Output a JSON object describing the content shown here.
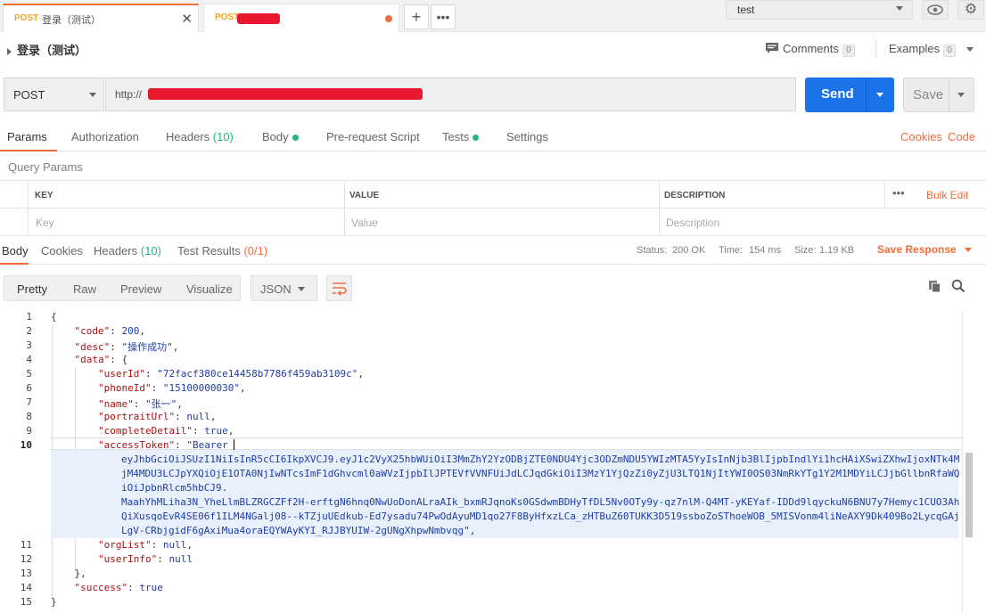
{
  "tabs": [
    {
      "method": "POST",
      "name": "登录（测试）"
    },
    {
      "method": "POST",
      "name": ""
    }
  ],
  "environment": {
    "selected": "test"
  },
  "request": {
    "name": "登录（测试）",
    "comments_label": "Comments",
    "comments_count": "0",
    "examples_label": "Examples",
    "examples_count": "0",
    "method": "POST",
    "url_prefix": "http://",
    "send_label": "Send",
    "save_label": "Save"
  },
  "request_tabs": {
    "params": "Params",
    "authorization": "Authorization",
    "headers": "Headers",
    "headers_count": "(10)",
    "body": "Body",
    "prerequest": "Pre-request Script",
    "tests": "Tests",
    "settings": "Settings",
    "cookies": "Cookies",
    "code": "Code"
  },
  "query_params": {
    "title": "Query Params",
    "col_key": "KEY",
    "col_value": "VALUE",
    "col_description": "DESCRIPTION",
    "bulk_edit": "Bulk Edit",
    "ph_key": "Key",
    "ph_value": "Value",
    "ph_description": "Description"
  },
  "response_tabs": {
    "body": "Body",
    "cookies": "Cookies",
    "headers": "Headers",
    "headers_count": "(10)",
    "test_results": "Test Results",
    "test_count": "(0/1)",
    "status_label": "Status:",
    "status_value": "200 OK",
    "time_label": "Time:",
    "time_value": "154 ms",
    "size_label": "Size:",
    "size_value": "1.19 KB",
    "save_response": "Save Response"
  },
  "response_toolbar": {
    "pretty": "Pretty",
    "raw": "Raw",
    "preview": "Preview",
    "visualize": "Visualize",
    "format": "JSON"
  },
  "body": {
    "line_numbers": [
      "1",
      "2",
      "3",
      "4",
      "5",
      "6",
      "7",
      "8",
      "9",
      "10",
      "11",
      "12",
      "13",
      "14",
      "15"
    ],
    "code_value": "200",
    "desc_value": "\"操作成功\"",
    "userId": "\"72facf380ce14458b7786f459ab3109c\"",
    "phoneId": "\"15100000030\"",
    "name": "\"张一\"",
    "portraitUrl": "null",
    "completeDetail": "true",
    "accessToken_start": "\"Bearer ",
    "token_lines": [
      "eyJhbGciOiJSUzI1NiIsInR5cCI6IkpXVCJ9.eyJ1c2VyX25hbWUiOiI3MmZhY2YzODBjZTE0NDU4Yjc3ODZmNDU5YWIzMTA5YyIsInNjb3BlIjpbIndlYi1hcHAiXSwiZXhwIjoxNTk4M",
      "jM4MDU3LCJpYXQiOjE1OTA0NjIwNTcsImF1dGhvcml0aWVzIjpbIlJPTEVfVVNFUiJdLCJqdGkiOiI3MzY1YjQzZi0yZjU3LTQ1NjItYWI0OS03NmRkYTg1Y2M1MDYiLCJjbGllbnRfaWQ",
      "iOiJpbnRlcm5hbCJ9.",
      "MaahYhMLiha3N_YheLlmBLZRGCZFf2H-erftgN6hnq0NwUoDonALraAIk_bxmRJqnoKs0GSdwmBDHyTfDL5Nv0OTy9y-qz7nlM-Q4MT-yKEYaf-IDDd9lqyckuN6BNU7y7Hemyc1CUO3Ah",
      "QiXusqoEvR4SE06f1ILM4NGalj08--kTZjuUEdkub-Ed7ysadu74PwOdAyuMD1qo27F8ByHfxzLCa_zHTBuZ60TUKK3D519ssboZoSThoeWOB_5MISVonm4liNeAXY9Dk409Bo2LycqGAj",
      "LgV-CRbjgidF6gAxiMua4oraEQYWAyKYI_RJJBYUIW-2gUNgXhpwNmbvqg\","
    ],
    "orgList": "null",
    "userInfo": "null",
    "success": "true"
  }
}
